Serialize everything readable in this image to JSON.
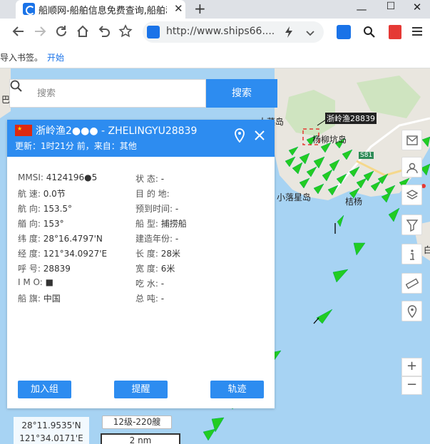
{
  "browser": {
    "tab_title": "船顺网-船舶信息免费查询,船舶动",
    "tab_close": "✕",
    "new_tab": "+",
    "minimize": "—",
    "maximize": "☐",
    "close": "✕",
    "url": "http://www.ships66....",
    "bookmark_hint": "导入书签。",
    "bookmark_start": "开始"
  },
  "search": {
    "placeholder": "搜索",
    "button": "搜索"
  },
  "map_labels": {
    "ship_tag": "浙岭渔28839",
    "island1": "大菜岛",
    "island2": "小落星岛",
    "place1": "杨柳坑岛",
    "place2": "桔杨",
    "road": "S81",
    "left_edge": "巴",
    "right_edge": "白"
  },
  "panel": {
    "name": "浙岭渔2●●● - ZHELINGYU28839",
    "update": "更新：1时21分 前，来自：其他",
    "left": [
      {
        "label": "MMSI:",
        "value": "4124196●5"
      },
      {
        "label": "航  速:",
        "value": "0.0节"
      },
      {
        "label": "航  向:",
        "value": "153.5°"
      },
      {
        "label": "艏  向:",
        "value": "153°"
      },
      {
        "label": "纬  度:",
        "value": "28°16.4797'N"
      },
      {
        "label": "经  度:",
        "value": "121°34.0927'E"
      },
      {
        "label": "呼  号:",
        "value": "28839"
      },
      {
        "label": "I M O:",
        "value": "■"
      },
      {
        "label": "船  旗:",
        "value": "中国"
      }
    ],
    "right": [
      {
        "label": "状     态:",
        "value": "-"
      },
      {
        "label": "目  的  地:",
        "value": ""
      },
      {
        "label": "预到时间:",
        "value": "-"
      },
      {
        "label": "船     型:",
        "value": "捕捞船"
      },
      {
        "label": "建造年份:",
        "value": "-"
      },
      {
        "label": "长     度:",
        "value": "28米"
      },
      {
        "label": "宽     度:",
        "value": "6米"
      },
      {
        "label": "吃     水:",
        "value": "-"
      },
      {
        "label": "总     吨:",
        "value": "-"
      }
    ],
    "buttons": {
      "add_group": "加入组",
      "remind": "提醒",
      "track": "轨迹"
    }
  },
  "controls": {
    "zoom_in": "+",
    "zoom_out": "−"
  },
  "bottom": {
    "lat": "28°11.9535'N",
    "lon": "121°34.0171'E",
    "wind": "12级-220艘",
    "scale": "2 nm"
  }
}
